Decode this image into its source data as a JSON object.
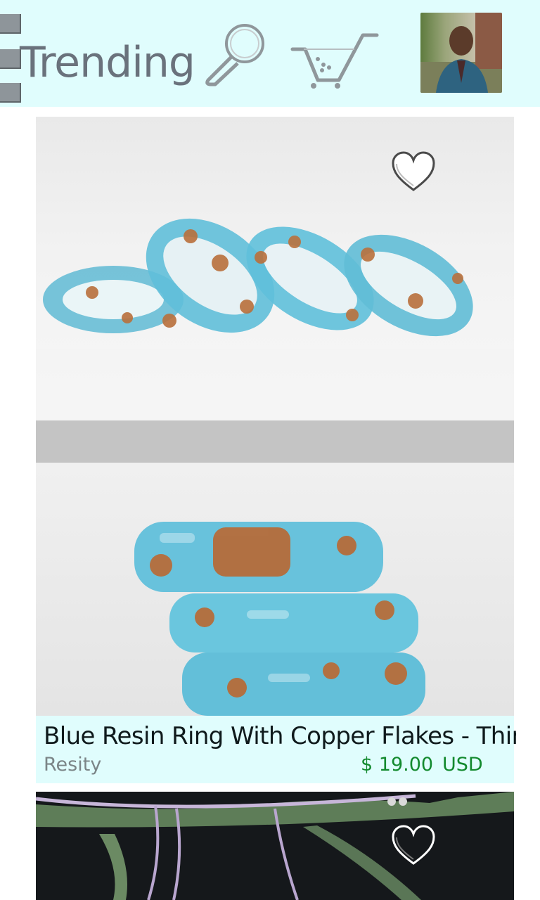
{
  "header": {
    "title": "Trending",
    "menu_icon": "hamburger-menu-icon",
    "search_icon": "magnifier-search-icon",
    "cart_icon": "shopping-cart-icon",
    "avatar": "user-profile-photo"
  },
  "colors": {
    "header_bg": "#e0fdfd",
    "title": "#6a727c",
    "price": "#138a2e",
    "shop": "#7b8587",
    "divider": "#c4c4c4"
  },
  "feed": {
    "items": [
      {
        "image": "blue-resin-rings-row-photo",
        "favorite_icon": "heart-outline-icon"
      },
      {
        "image": "blue-resin-rings-stack-photo",
        "title": "Blue Resin Ring With Copper Flakes - Thin",
        "shop": "Resity",
        "price": "$ 19.00",
        "currency": "USD"
      },
      {
        "image": "green-leaves-twine-photo",
        "favorite_icon": "heart-outline-icon"
      }
    ]
  }
}
